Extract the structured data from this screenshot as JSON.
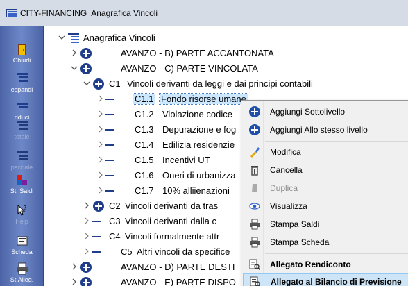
{
  "window": {
    "title": "CITY-FINANCING",
    "subtitle": "Anagrafica Vincoli"
  },
  "toolbar": {
    "buttons": [
      {
        "label": "Chiudi",
        "icon": "exit-door-icon",
        "enabled": true
      },
      {
        "label": "espandi",
        "icon": "expand-tree-icon",
        "enabled": true
      },
      {
        "label": "riduci",
        "icon": "collapse-tree-icon",
        "enabled": true
      },
      {
        "label": "totale",
        "icon": "expand-all-icon",
        "enabled": false
      },
      {
        "label": "parziale",
        "icon": "expand-partial-icon",
        "enabled": false
      },
      {
        "label": "St. Saldi",
        "icon": "print-balances-icon",
        "enabled": true
      },
      {
        "label": "Help",
        "icon": "help-pointer-icon",
        "enabled": false
      },
      {
        "label": "Scheda",
        "icon": "card-icon",
        "enabled": true
      },
      {
        "label": "St.Alleg.",
        "icon": "print-attachment-icon",
        "enabled": true
      }
    ]
  },
  "tree": {
    "root": "Anagrafica Vincoli",
    "nodes": [
      {
        "code": "",
        "label": "AVANZO - B) PARTE ACCANTONATA"
      },
      {
        "code": "",
        "label": "AVANZO - C) PARTE VINCOLATA"
      },
      {
        "code": "C1",
        "label": "Vincoli derivanti da leggi e dai principi contabili"
      },
      {
        "code": "C1.1",
        "label": "Fondo risorse umane"
      },
      {
        "code": "C1.2",
        "label": "Violazione codice"
      },
      {
        "code": "C1.3",
        "label": "Depurazione e fog"
      },
      {
        "code": "C1.4",
        "label": "Edilizia residenzie"
      },
      {
        "code": "C1.5",
        "label": "Incentivi UT"
      },
      {
        "code": "C1.6",
        "label": "Oneri di urbanizza"
      },
      {
        "code": "C1.7",
        "label": "10% alliienazioni"
      },
      {
        "code": "C2",
        "label": "Vincoli derivanti da tras"
      },
      {
        "code": "C3",
        "label": "Vincoli derivanti dalla c"
      },
      {
        "code": "C4",
        "label": "Vincoli formalmente attr"
      },
      {
        "code": "C5",
        "label": "Altri vincoli da specifice"
      },
      {
        "code": "",
        "label": "AVANZO - D) PARTE DESTI"
      },
      {
        "code": "",
        "label": "AVANZO - E) PARTE DISPO"
      }
    ]
  },
  "context_menu": {
    "items": [
      {
        "label": "Aggiungi Sottolivello",
        "icon": "add-circle-icon"
      },
      {
        "label": "Aggiungi Allo stesso livello",
        "icon": "add-circle-icon"
      },
      {
        "label": "Modifica",
        "icon": "edit-brush-icon"
      },
      {
        "label": "Cancella",
        "icon": "trash-icon"
      },
      {
        "label": "Duplica",
        "icon": "duplicate-icon"
      },
      {
        "label": "Visualizza",
        "icon": "eye-icon"
      },
      {
        "label": "Stampa Saldi",
        "icon": "printer-icon"
      },
      {
        "label": "Stampa Scheda",
        "icon": "printer-icon"
      },
      {
        "label": "Allegato Rendiconto",
        "icon": "report-magnifier-icon"
      },
      {
        "label": "Allegato al Bilancio di Previsione",
        "icon": "report-magnifier-icon"
      }
    ]
  },
  "colors": {
    "toolbar": "#5a74b8",
    "tree_line": "#1f3d8a",
    "selection": "#cce8ff",
    "menu_highlight": "#cde5f7"
  }
}
